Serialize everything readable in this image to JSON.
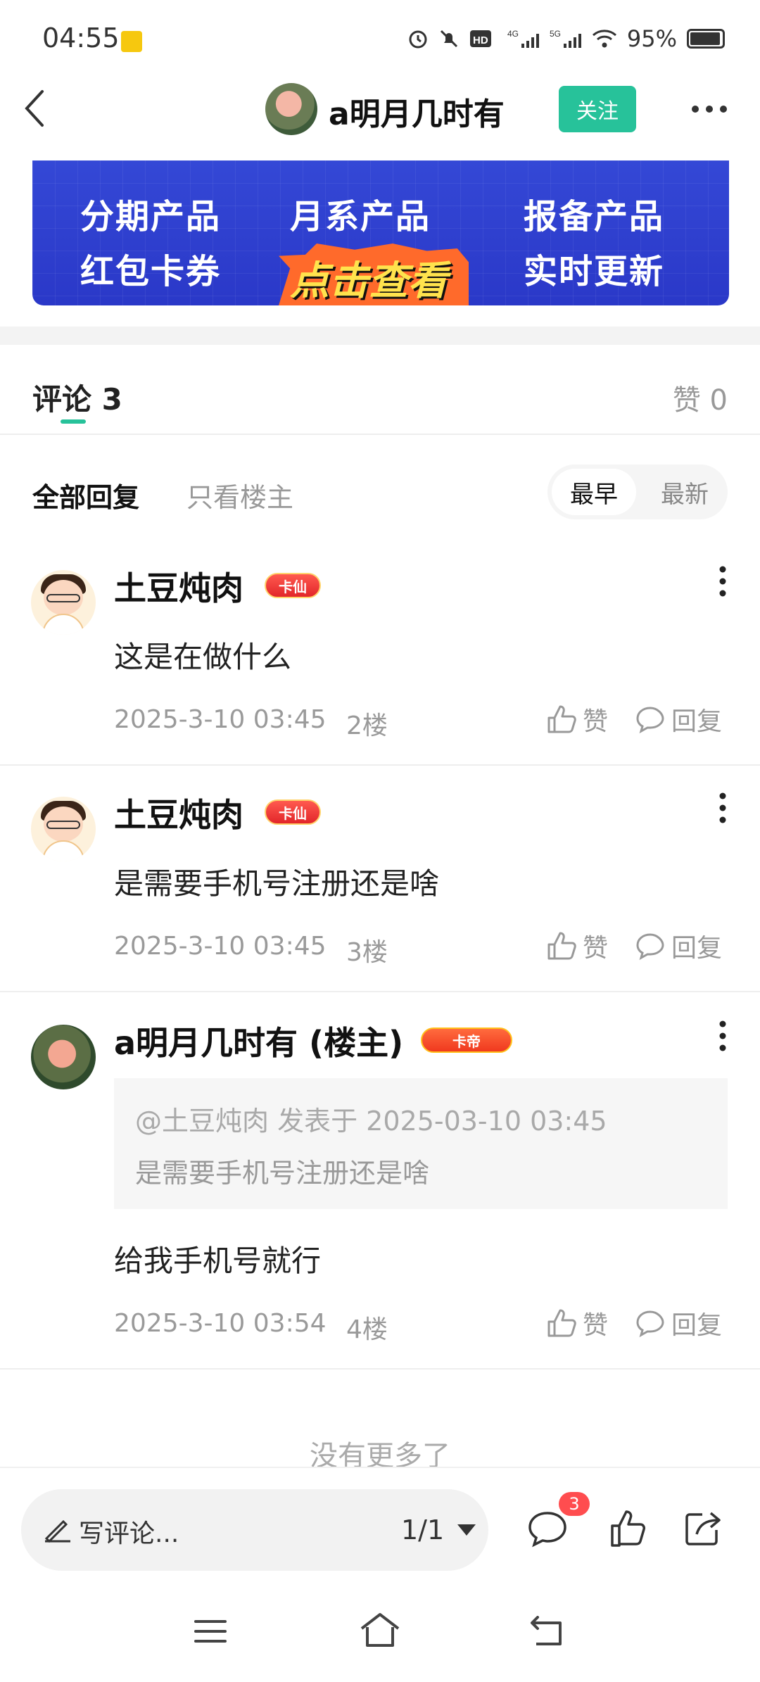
{
  "status_bar": {
    "time": "04:55",
    "battery": "95%",
    "icons": [
      "alarm-icon",
      "mute-icon",
      "hd-icon",
      "4g-signal-icon",
      "5g-signal-icon",
      "wifi-icon",
      "battery-icon"
    ]
  },
  "header": {
    "title": "a明月几时有",
    "follow_label": "关注"
  },
  "banner": {
    "items": [
      "分期产品",
      "月系产品",
      "报备产品",
      "红包卡券",
      "实时更新"
    ],
    "cta": "点击查看"
  },
  "comments_section": {
    "tab_label": "评论 3",
    "likes_label": "赞 0",
    "filters": {
      "all": "全部回复",
      "op_only": "只看楼主"
    },
    "sort": {
      "earliest": "最早",
      "latest": "最新"
    }
  },
  "comments": [
    {
      "name": "土豆炖肉",
      "badge": "卡仙",
      "text": "这是在做什么",
      "time": "2025-3-10 03:45",
      "floor": "2楼",
      "like": "赞",
      "reply": "回复"
    },
    {
      "name": "土豆炖肉",
      "badge": "卡仙",
      "text": "是需要手机号注册还是啥",
      "time": "2025-3-10 03:45",
      "floor": "3楼",
      "like": "赞",
      "reply": "回复"
    },
    {
      "name": "a明月几时有 (楼主)",
      "badge": "卡帝",
      "quote_header": "@土豆炖肉 发表于 2025-03-10 03:45",
      "quote_text": "是需要手机号注册还是啥",
      "text": "给我手机号就行",
      "time": "2025-3-10 03:54",
      "floor": "4楼",
      "like": "赞",
      "reply": "回复"
    }
  ],
  "no_more": "没有更多了",
  "bottom_bar": {
    "write_placeholder": "写评论...",
    "page_indicator": "1/1",
    "comment_count": "3"
  },
  "colors": {
    "accent": "#27c29a",
    "banner": "#2f3fd0",
    "badge_red": "#ff4d4f"
  }
}
